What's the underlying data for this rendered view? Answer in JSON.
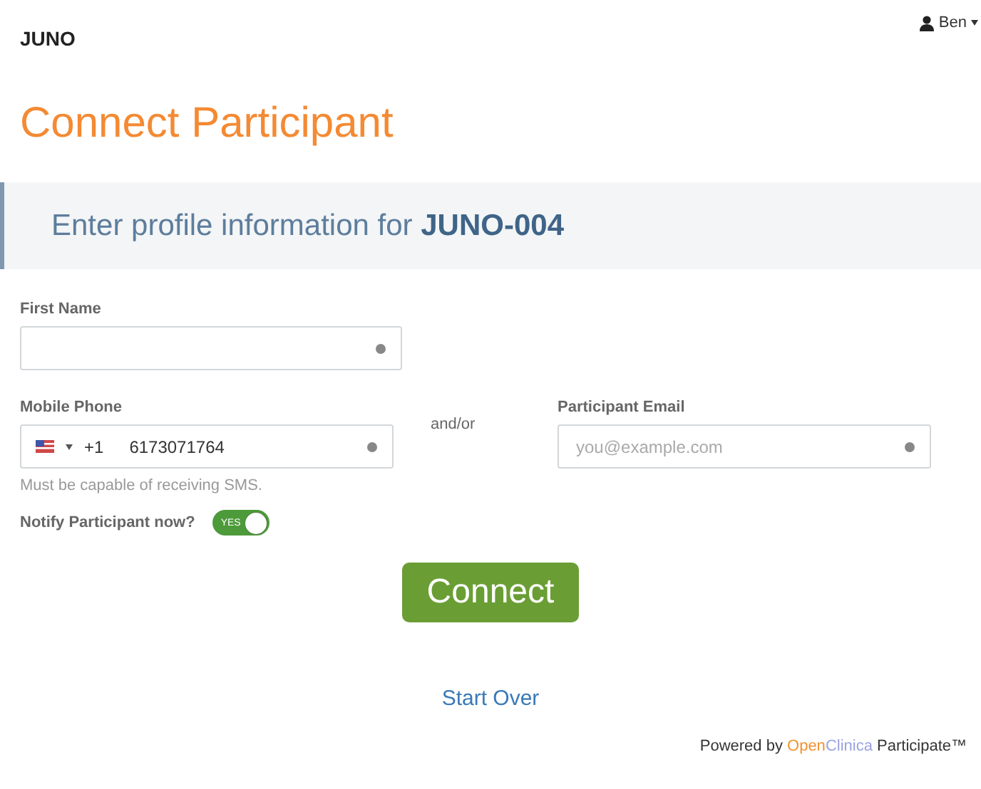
{
  "header": {
    "brand": "JUNO",
    "user": "Ben"
  },
  "title": "Connect Participant",
  "banner": {
    "text": "Enter profile information for **JUNO-004**"
  },
  "first_name": {
    "label": "First Name",
    "required": true
  },
  "phone": {
    "label": "Mobile Phone",
    "country_code": "+1",
    "value": "6173071764",
    "required": true,
    "hint": "Must be capable of receiving SMS."
  },
  "separator": "and/or",
  "email": {
    "label": "Participant Email",
    "placeholder": "you@example.com",
    "required": true
  },
  "notify": {
    "label": "Notify Participant now?",
    "on": true,
    "on_text": "YES"
  },
  "connect_button": "Connect",
  "start_over": "Start Over",
  "footer": {
    "lead": "Powered by",
    "brand_first": "Open",
    "brand_second": "Clinica",
    "product": "Participate™"
  }
}
